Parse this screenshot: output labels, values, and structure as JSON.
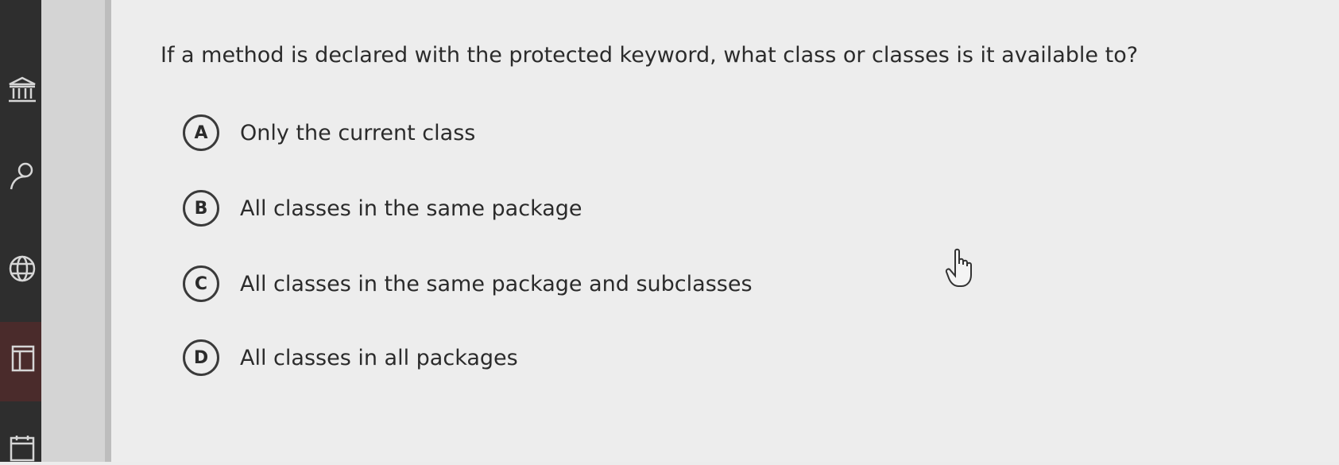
{
  "question": {
    "text": "If a method is declared with the protected keyword, what class or classes is it available to?"
  },
  "options": [
    {
      "letter": "A",
      "text": "Only the current class"
    },
    {
      "letter": "B",
      "text": "All classes in the same package"
    },
    {
      "letter": "C",
      "text": "All classes in the same package and subclasses"
    },
    {
      "letter": "D",
      "text": "All classes in all packages"
    }
  ],
  "sidebar": {
    "icons": [
      "institution-icon",
      "user-icon",
      "globe-icon",
      "book-icon",
      "calendar-icon"
    ]
  },
  "cursor": {
    "icon": "hand-pointer-icon"
  },
  "colors": {
    "background": "#ededed",
    "sidebar": "#2e2e2e",
    "text": "#2b2b2b"
  }
}
